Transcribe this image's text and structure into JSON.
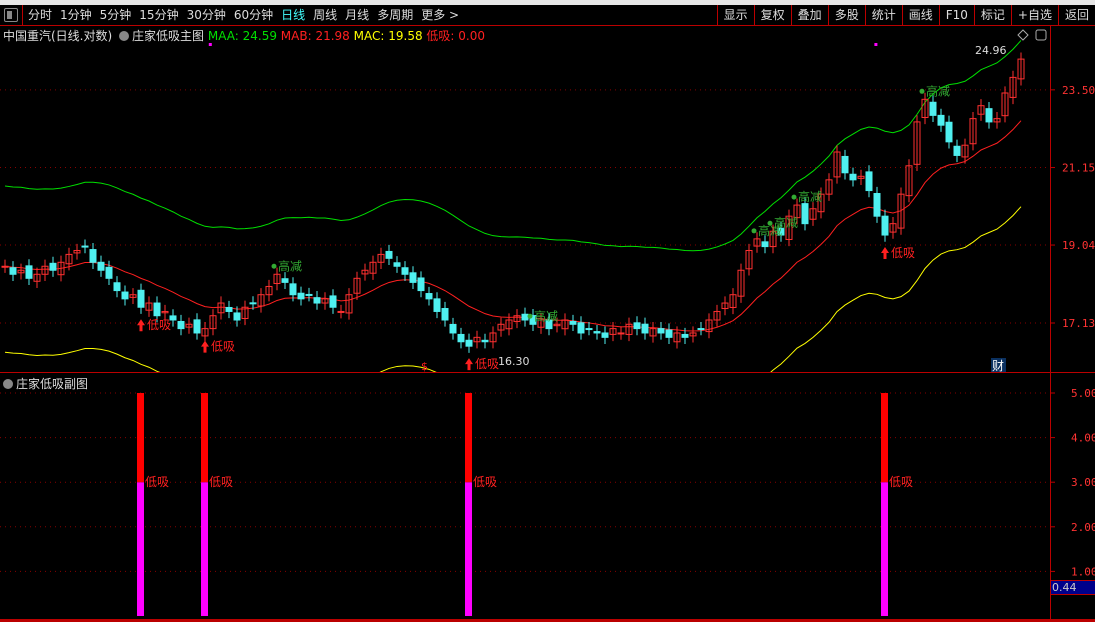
{
  "toolbar": {
    "periods": [
      "分时",
      "1分钟",
      "5分钟",
      "15分钟",
      "30分钟",
      "60分钟",
      "日线",
      "周线",
      "月线",
      "多周期",
      "更多 >"
    ],
    "active": "日线",
    "buttons": [
      "显示",
      "复权",
      "叠加",
      "多股",
      "统计",
      "画线",
      "F10",
      "标记",
      "+自选",
      "返回"
    ]
  },
  "info": {
    "stock": "中国重汽(日线.对数)",
    "indicator": "庄家低吸主图",
    "maa": "MAA: 24.59",
    "mab": "MAB: 21.98",
    "mac": "MAC: 19.58",
    "low": "低吸: 0.00"
  },
  "colors": {
    "up": "#ff3030",
    "down": "#4ff0f0",
    "maa": "#00e000",
    "mab": "#ff2020",
    "mac": "#ffff00",
    "low": "#ff00ff"
  },
  "sub": {
    "title": "庄家低吸副图",
    "current": "0.44"
  },
  "chart_data": {
    "type": "candlestick",
    "scale": "log",
    "y_ticks": [
      "23.50",
      "21.15",
      "19.04",
      "17.13"
    ],
    "y_tick_values": [
      23.5,
      21.15,
      19.04,
      17.13
    ],
    "close": [
      18.5,
      18.3,
      18.4,
      18.2,
      18.3,
      18.5,
      18.4,
      18.6,
      18.8,
      18.9,
      19.0,
      18.6,
      18.4,
      18.2,
      17.9,
      17.7,
      17.8,
      17.5,
      17.6,
      17.3,
      17.4,
      17.2,
      17.0,
      17.1,
      16.9,
      17.0,
      17.3,
      17.6,
      17.4,
      17.2,
      17.5,
      17.6,
      17.8,
      18.0,
      18.3,
      18.1,
      17.8,
      17.7,
      17.8,
      17.6,
      17.7,
      17.5,
      17.4,
      17.8,
      18.2,
      18.4,
      18.6,
      18.8,
      18.7,
      18.5,
      18.3,
      18.1,
      17.9,
      17.7,
      17.4,
      17.2,
      16.9,
      16.7,
      16.6,
      16.8,
      16.7,
      16.9,
      17.1,
      17.2,
      17.3,
      17.2,
      17.1,
      17.2,
      17.0,
      17.1,
      17.2,
      17.1,
      16.9,
      17.0,
      16.9,
      16.8,
      17.0,
      16.9,
      17.1,
      17.0,
      16.9,
      17.0,
      16.9,
      16.8,
      16.9,
      16.8,
      16.9,
      17.0,
      17.2,
      17.4,
      17.6,
      17.8,
      18.4,
      18.9,
      19.2,
      19.0,
      19.4,
      19.3,
      19.8,
      20.1,
      19.6,
      20.0,
      20.4,
      20.8,
      21.6,
      21.0,
      20.8,
      20.9,
      20.5,
      19.8,
      19.3,
      19.6,
      20.4,
      21.2,
      22.5,
      23.2,
      22.7,
      22.4,
      21.9,
      21.5,
      21.8,
      22.6,
      23.0,
      22.5,
      22.6,
      23.4,
      23.9,
      24.5
    ],
    "max_label": "24.96",
    "min_label": "16.30",
    "signals_low": [
      {
        "index": 17,
        "label": "低吸"
      },
      {
        "index": 25,
        "label": "低吸"
      },
      {
        "index": 58,
        "label": "低吸"
      },
      {
        "index": 110,
        "label": "低吸"
      }
    ],
    "signals_high": [
      {
        "index": 34,
        "label": "高减"
      },
      {
        "index": 66,
        "label": "高减"
      },
      {
        "index": 94,
        "label": "高减"
      },
      {
        "index": 96,
        "label": "高减"
      },
      {
        "index": 99,
        "label": "高减"
      },
      {
        "index": 115,
        "label": "高减"
      }
    ],
    "bottom_marks": {
      "dollar": "$",
      "finance": "财"
    },
    "sub_chart": {
      "type": "bar",
      "y_ticks": [
        "5.00",
        "4.00",
        "3.00",
        "2.00",
        "1.00"
      ],
      "ylim": [
        0,
        5
      ],
      "bars": [
        {
          "index": 17,
          "low": 3,
          "high": 5,
          "label": "低吸"
        },
        {
          "index": 25,
          "low": 3,
          "high": 5,
          "label": "低吸"
        },
        {
          "index": 58,
          "low": 3,
          "high": 5,
          "label": "低吸"
        },
        {
          "index": 110,
          "low": 3,
          "high": 5,
          "label": "低吸"
        }
      ]
    }
  }
}
